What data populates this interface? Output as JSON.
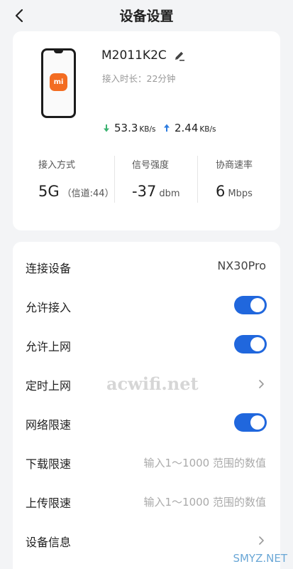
{
  "header": {
    "title": "设备设置"
  },
  "device": {
    "name": "M2011K2C",
    "online_time": "接入时长：22分钟",
    "logo_text": "mi",
    "download_speed": "53.3",
    "download_unit": "KB/s",
    "upload_speed": "2.44",
    "upload_unit": "KB/s"
  },
  "stats": {
    "access": {
      "label": "接入方式",
      "value": "5G",
      "extra": "（信道:44）"
    },
    "signal": {
      "label": "信号强度",
      "value": "-37",
      "unit": "dbm"
    },
    "rate": {
      "label": "协商速率",
      "value": "6",
      "unit": "Mbps"
    }
  },
  "settings": {
    "connected_device": {
      "label": "连接设备",
      "value": "NX30Pro"
    },
    "allow_access": {
      "label": "允许接入",
      "on": true
    },
    "allow_internet": {
      "label": "允许上网",
      "on": true
    },
    "scheduled_internet": {
      "label": "定时上网"
    },
    "speed_limit": {
      "label": "网络限速",
      "on": true
    },
    "download_limit": {
      "label": "下载限速",
      "placeholder": "输入1～1000 范围的数值"
    },
    "upload_limit": {
      "label": "上传限速",
      "placeholder": "输入1～1000 范围的数值"
    },
    "device_info": {
      "label": "设备信息"
    }
  },
  "watermarks": {
    "center": "acwifi.net",
    "corner": "SMYZ.NET"
  },
  "colors": {
    "accent": "#2067dd",
    "download_arrow": "#3cb371",
    "upload_arrow": "#2e7de0",
    "brand": "#f36c21"
  }
}
